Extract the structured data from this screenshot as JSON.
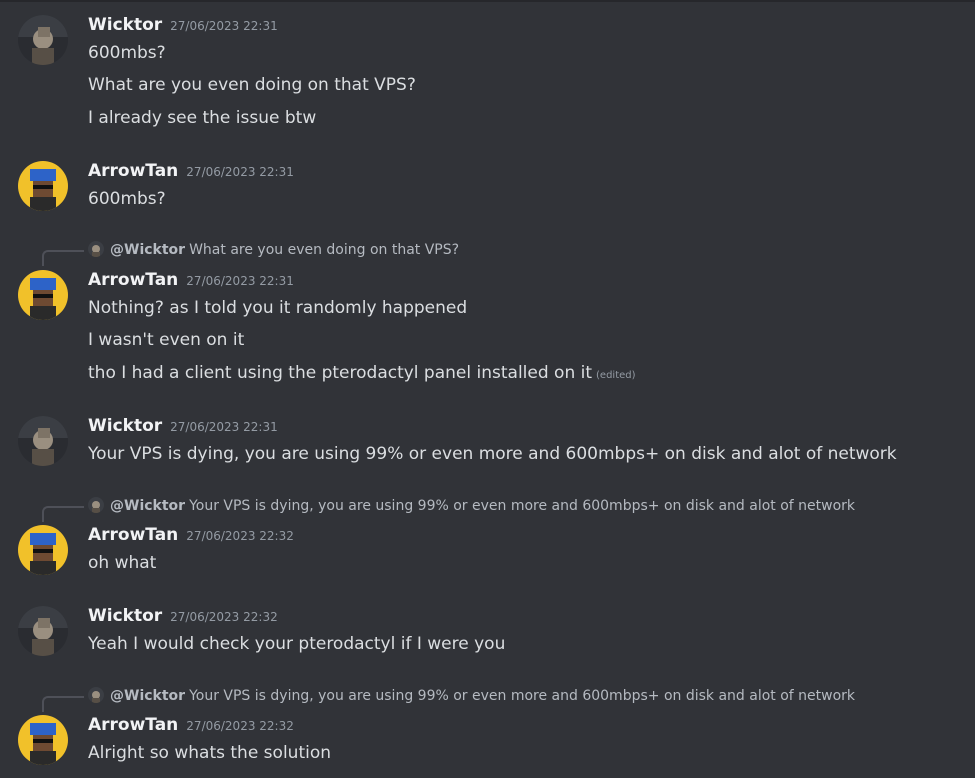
{
  "users": {
    "wicktor": {
      "name": "Wicktor",
      "mention": "@Wicktor"
    },
    "arrowtan": {
      "name": "ArrowTan"
    }
  },
  "messages": [
    {
      "author": "Wicktor",
      "timestamp": "27/06/2023 22:31",
      "lines": [
        "600mbs?",
        "What are you even doing on that VPS?",
        "I already see the issue btw"
      ]
    },
    {
      "author": "ArrowTan",
      "timestamp": "27/06/2023 22:31",
      "lines": [
        "600mbs?"
      ]
    },
    {
      "author": "ArrowTan",
      "timestamp": "27/06/2023 22:31",
      "reply": {
        "mention": "@Wicktor",
        "text": "What are you even doing on that VPS?"
      },
      "lines": [
        "Nothing? as I told you it randomly happened",
        "I wasn't even on it",
        "tho I had a client using the pterodactyl panel installed on it"
      ],
      "edited": "(edited)"
    },
    {
      "author": "Wicktor",
      "timestamp": "27/06/2023 22:31",
      "lines": [
        "Your VPS is dying, you are using 99% or even more and 600mbps+ on disk and alot of network"
      ]
    },
    {
      "author": "ArrowTan",
      "timestamp": "27/06/2023 22:32",
      "reply": {
        "mention": "@Wicktor",
        "text": "Your VPS is dying, you are using 99% or even more and 600mbps+ on disk and alot of network"
      },
      "lines": [
        "oh what"
      ]
    },
    {
      "author": "Wicktor",
      "timestamp": "27/06/2023 22:32",
      "lines": [
        "Yeah I would check  your pterodactyl if I were you"
      ]
    },
    {
      "author": "ArrowTan",
      "timestamp": "27/06/2023 22:32",
      "reply": {
        "mention": "@Wicktor",
        "text": "Your VPS is dying, you are using 99% or even more and 600mbps+ on disk and alot of network"
      },
      "lines": [
        "Alright so whats the solution"
      ]
    }
  ],
  "icons": {
    "wicktor_avatar": "user-avatar-icon",
    "arrowtan_avatar": "user-avatar-icon"
  },
  "colors": {
    "background": "#313338",
    "username": "#f2f3f5",
    "text": "#dbdee1",
    "muted": "#949ba4"
  }
}
